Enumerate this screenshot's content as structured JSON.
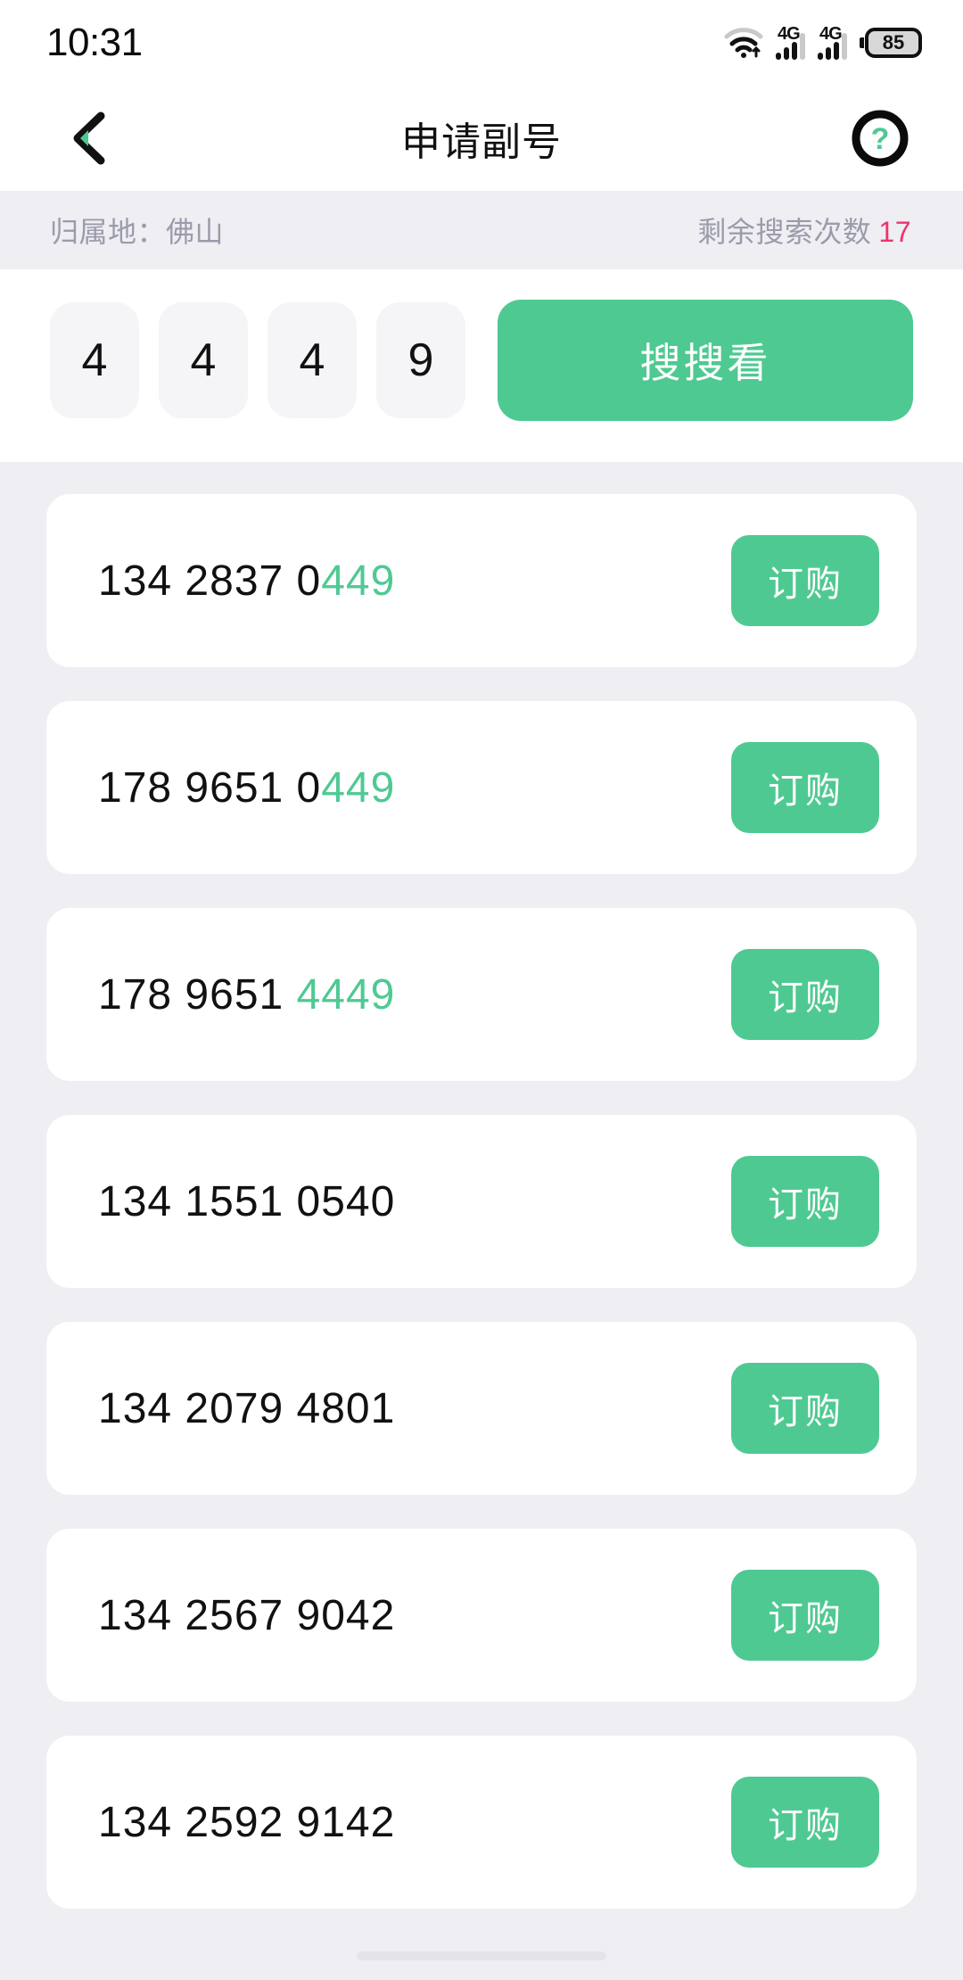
{
  "status_bar": {
    "time": "10:31",
    "wifi_icon": "wifi-icon",
    "signal_1_label": "4G",
    "signal_2_label": "4G",
    "battery_level": "85"
  },
  "nav_bar": {
    "back_icon": "back-chevron-icon",
    "title": "申请副号",
    "help_icon": "help-question-icon"
  },
  "info_strip": {
    "location_label": "归属地：佛山",
    "remaining_label": "剩余搜索次数",
    "remaining_count": "17"
  },
  "search_panel": {
    "digits": [
      "4",
      "4",
      "4",
      "9"
    ],
    "search_button_label": "搜搜看"
  },
  "results": {
    "order_button_label": "订购",
    "items": [
      {
        "prefix": "134 2837 0",
        "highlight": "449"
      },
      {
        "prefix": "178 9651 0",
        "highlight": "449"
      },
      {
        "prefix": "178 9651 ",
        "highlight": "4449"
      },
      {
        "prefix": "134 1551 0540",
        "highlight": ""
      },
      {
        "prefix": "134 2079 4801",
        "highlight": ""
      },
      {
        "prefix": "134 2567 9042",
        "highlight": ""
      },
      {
        "prefix": "134 2592 9142",
        "highlight": ""
      }
    ]
  },
  "colors": {
    "accent_green": "#4fc992",
    "alert_pink": "#f0336c",
    "page_background": "#eeeef3",
    "card_background": "#ffffff",
    "muted_text": "#9b9baa"
  }
}
